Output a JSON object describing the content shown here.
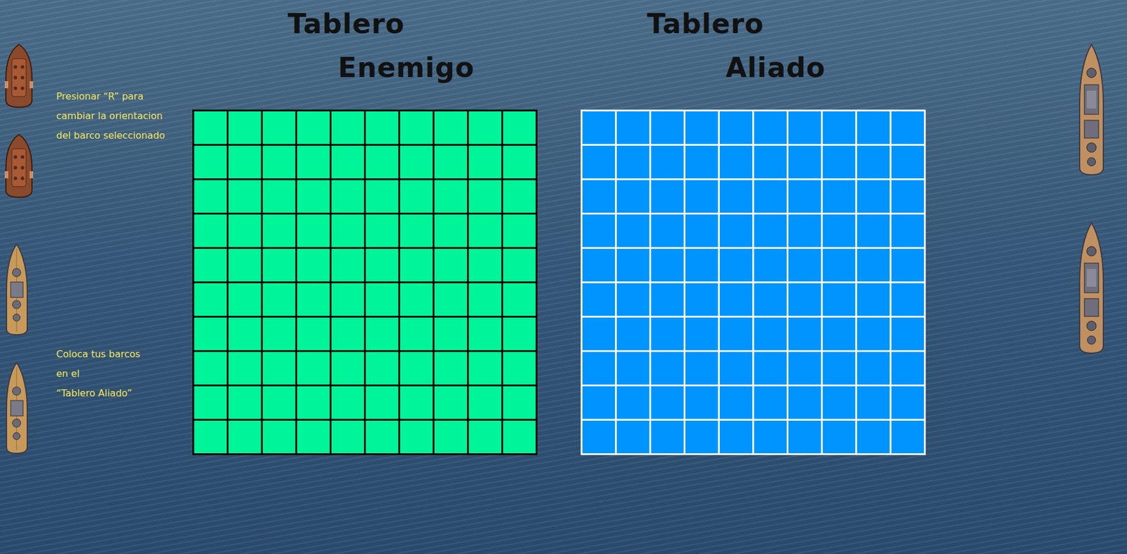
{
  "boards": [
    {
      "kind": "enemy",
      "title": [
        "Tablero",
        "Enemigo"
      ],
      "rows": 10,
      "cols": 10
    },
    {
      "kind": "ally",
      "title": [
        "Tablero",
        "Aliado"
      ],
      "rows": 10,
      "cols": 10
    }
  ],
  "instructions": [
    [
      "Presionar “R” para",
      "cambiar la orientacion",
      "del barco seleccionado"
    ],
    [
      "Coloca tus barcos",
      "en el",
      "“Tablero Aliado”"
    ]
  ],
  "left_fleet": [
    {
      "kind": "cargo"
    },
    {
      "kind": "cargo"
    },
    {
      "kind": "destroyer"
    },
    {
      "kind": "destroyer"
    }
  ],
  "right_fleet": [
    {
      "kind": "battleship"
    },
    {
      "kind": "battleship"
    }
  ]
}
